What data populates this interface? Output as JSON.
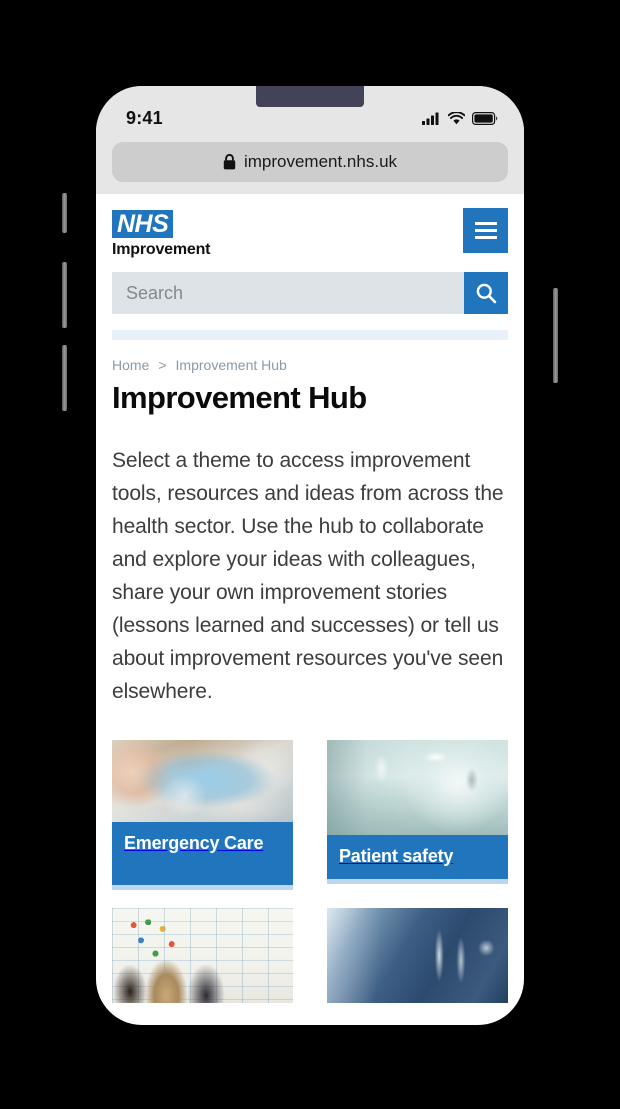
{
  "device": {
    "status_bar": {
      "time": "9:41",
      "cellular_icon": "cellular-bars-icon",
      "wifi_icon": "wifi-icon",
      "battery_icon": "battery-full-icon"
    },
    "buttons": {
      "silence_switch": "silence-switch",
      "volume_up": "volume-up-button",
      "volume_down": "volume-down-button",
      "power": "power-button"
    }
  },
  "browser": {
    "lock_icon": "lock-icon",
    "url": "improvement.nhs.uk"
  },
  "site_header": {
    "logo": {
      "badge_text": "NHS",
      "sub_text": "Improvement"
    },
    "menu_button_label": "menu-icon",
    "search": {
      "placeholder": "Search",
      "value": "",
      "button_icon": "search-icon"
    }
  },
  "breadcrumb": {
    "items": [
      {
        "label": "Home"
      },
      {
        "label": "Improvement Hub"
      }
    ],
    "separator": ">"
  },
  "page": {
    "title": "Improvement Hub",
    "intro": "Select a theme to access improvement tools, resources and ideas from across the health sector. Use the hub to collaborate and explore your ideas with colleagues, share your own improvement stories (lessons learned and successes) or tell us about improvement resources you've seen elsewhere."
  },
  "theme_cards": [
    {
      "label": "Emergency Care",
      "image": "emergency-resuscitation-photo"
    },
    {
      "label": "Patient safety",
      "image": "hospital-corridor-photo"
    },
    {
      "label": "",
      "image": "staff-planning-board-photo"
    },
    {
      "label": "",
      "image": "scrubs-stethoscope-photo"
    }
  ],
  "colors": {
    "nhs_blue": "#2175bc",
    "card_underline": "#bcd7ec",
    "divider": "#e8f0f9",
    "search_field": "#dde3e6",
    "chrome_gray": "#e6e6e6",
    "url_pill": "#cdcdcd",
    "notch": "#424258"
  }
}
